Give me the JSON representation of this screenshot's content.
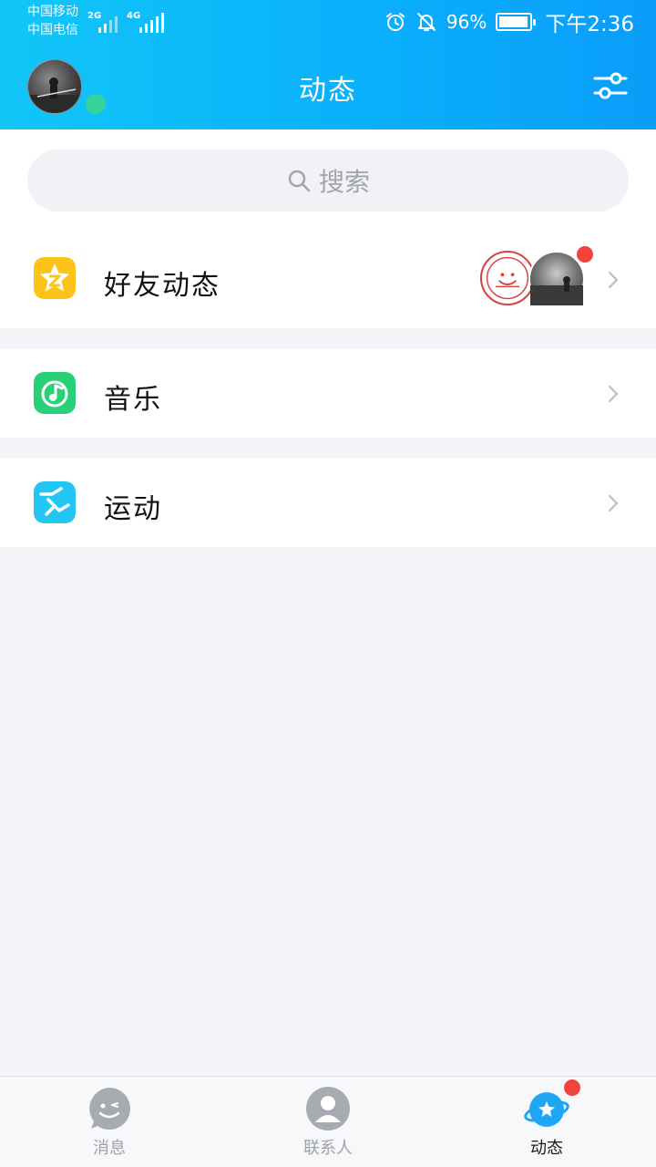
{
  "status_bar": {
    "carrier1": "中国移动",
    "carrier2": "中国电信",
    "net1": "2G",
    "net2": "4G",
    "battery_pct": "96%",
    "battery_level": 0.96,
    "time": "下午2:36",
    "icons": [
      "alarm-icon",
      "bell-muted-icon",
      "battery-icon"
    ]
  },
  "header": {
    "title": "动态",
    "online_color": "#34d39a",
    "brand_color": "#0ab0fb"
  },
  "search": {
    "placeholder": "搜索"
  },
  "list": [
    {
      "label": "好友动态",
      "icon": "friends-star-icon",
      "icon_color": "#fcc419",
      "has_badge": true
    },
    {
      "label": "音乐",
      "icon": "music-note-icon",
      "icon_color": "#28d077"
    },
    {
      "label": "运动",
      "icon": "running-icon",
      "icon_color": "#23c5f2"
    }
  ],
  "tabs": [
    {
      "label": "消息",
      "icon": "message-smile-icon",
      "active": false
    },
    {
      "label": "联系人",
      "icon": "contacts-icon",
      "active": false
    },
    {
      "label": "动态",
      "icon": "planet-star-icon",
      "active": true,
      "has_badge": true
    }
  ],
  "colors": {
    "badge_red": "#f2433c",
    "tab_inactive": "#9ea1aa",
    "tab_active_icon": "#1fa6f5"
  }
}
